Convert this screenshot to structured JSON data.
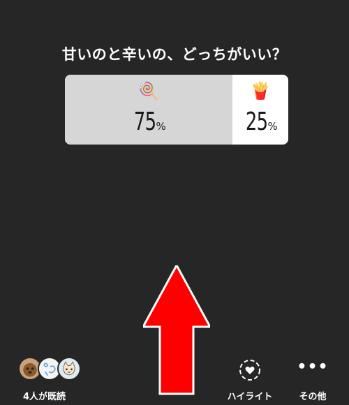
{
  "question": "甘いのと辛いの、どっちがいい？",
  "poll": {
    "options": [
      {
        "emoji": "🍭",
        "emoji_name": "lollipop-icon",
        "percent": 75,
        "percent_label": "75",
        "sign": "%"
      },
      {
        "emoji": "🍟",
        "emoji_name": "fries-icon",
        "percent": 25,
        "percent_label": "25",
        "sign": "%"
      }
    ],
    "colors": {
      "winner_bg": "#d6d6d6",
      "loser_bg": "#ffffff"
    }
  },
  "overlay_arrow": {
    "direction": "up",
    "color": "#ff0000"
  },
  "viewers": {
    "label": "4人が既読",
    "avatars": [
      "avatar-dog",
      "avatar-text",
      "avatar-cat"
    ]
  },
  "actions": {
    "highlight_label": "ハイライト",
    "more_label": "その他",
    "more_icon": "•••"
  }
}
